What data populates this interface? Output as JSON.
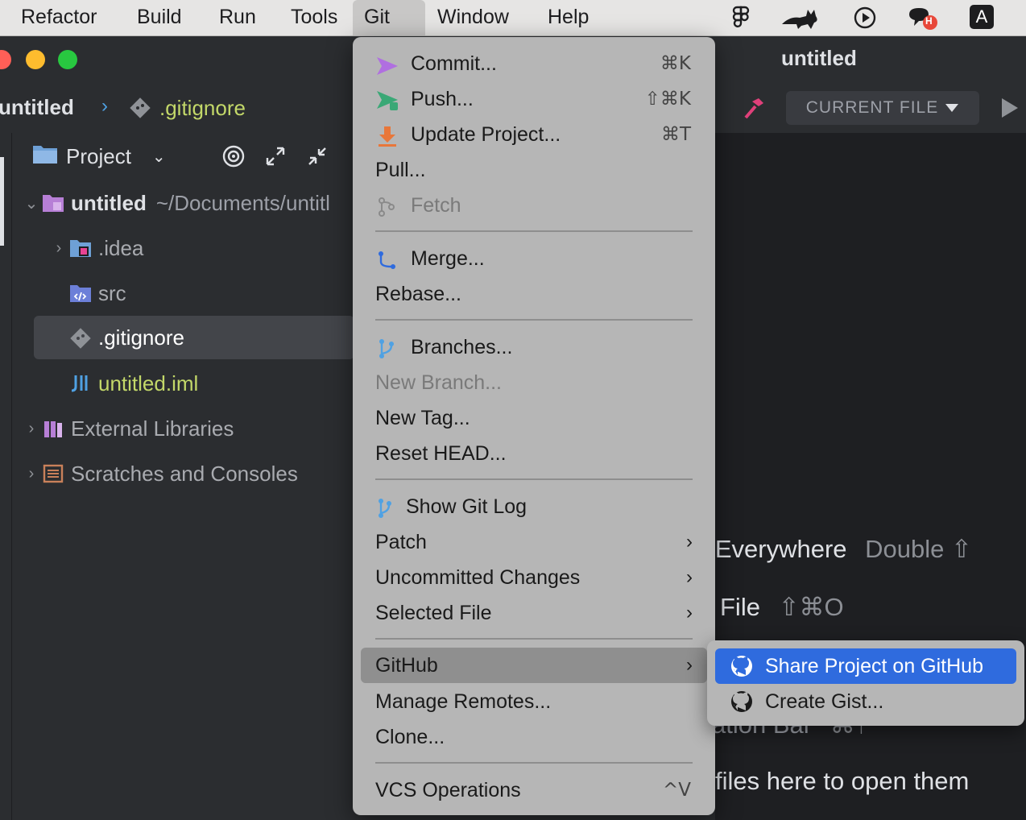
{
  "menubar": {
    "items": [
      "Refactor",
      "Build",
      "Run",
      "Tools",
      "Git",
      "Window",
      "Help"
    ],
    "active": "Git",
    "status_icons": [
      "figma-icon",
      "cat-icon",
      "play-circle-icon",
      "chat-notification-icon",
      "input-source-icon"
    ],
    "notification_badge": "H",
    "input_source_label": "A"
  },
  "window": {
    "title": "untitled"
  },
  "navbar": {
    "project": "untitled",
    "file": ".gitignore",
    "run_config": "CURRENT FILE"
  },
  "project_panel": {
    "title": "Project",
    "tree": [
      {
        "label": "untitled",
        "suffix": "~/Documents/untitl",
        "type": "root-folder"
      },
      {
        "label": ".idea",
        "type": "idea-folder"
      },
      {
        "label": "src",
        "type": "source-folder"
      },
      {
        "label": ".gitignore",
        "type": "gitignore-file",
        "selected": true
      },
      {
        "label": "untitled.iml",
        "type": "iml-file"
      },
      {
        "label": "External Libraries",
        "type": "libraries"
      },
      {
        "label": "Scratches and Consoles",
        "type": "scratches"
      }
    ]
  },
  "editor_hints": {
    "search_everywhere": {
      "label": "h Everywhere",
      "key": "Double ⇧"
    },
    "go_to_file": {
      "label": "File",
      "key": "⇧⌘O"
    },
    "nav_bar": {
      "label": "ation Bar",
      "key": "⌘↑"
    },
    "drop_files": "files here to open them"
  },
  "git_menu": {
    "commit": {
      "label": "Commit...",
      "shortcut": "⌘K"
    },
    "push": {
      "label": "Push...",
      "shortcut": "⇧⌘K"
    },
    "update": {
      "label": "Update Project...",
      "shortcut": "⌘T"
    },
    "pull": {
      "label": "Pull..."
    },
    "fetch": {
      "label": "Fetch"
    },
    "merge": {
      "label": "Merge..."
    },
    "rebase": {
      "label": "Rebase..."
    },
    "branches": {
      "label": "Branches..."
    },
    "new_branch": {
      "label": "New Branch..."
    },
    "new_tag": {
      "label": "New Tag..."
    },
    "reset_head": {
      "label": "Reset HEAD..."
    },
    "show_git_log": {
      "label": "Show Git Log"
    },
    "patch": {
      "label": "Patch"
    },
    "uncommitted": {
      "label": "Uncommitted Changes"
    },
    "selected_file": {
      "label": "Selected File"
    },
    "github": {
      "label": "GitHub"
    },
    "manage_remotes": {
      "label": "Manage Remotes..."
    },
    "clone": {
      "label": "Clone..."
    },
    "vcs_operations": {
      "label": "VCS Operations",
      "shortcut": "^V"
    }
  },
  "github_submenu": {
    "share": "Share Project on GitHub",
    "gist": "Create Gist..."
  },
  "colors": {
    "accent": "#2f6bde",
    "menu_bg": "#b6b6b6",
    "ide_bg": "#2b2d30",
    "editor_bg": "#1e1f22",
    "file_modified": "#c3d869"
  }
}
